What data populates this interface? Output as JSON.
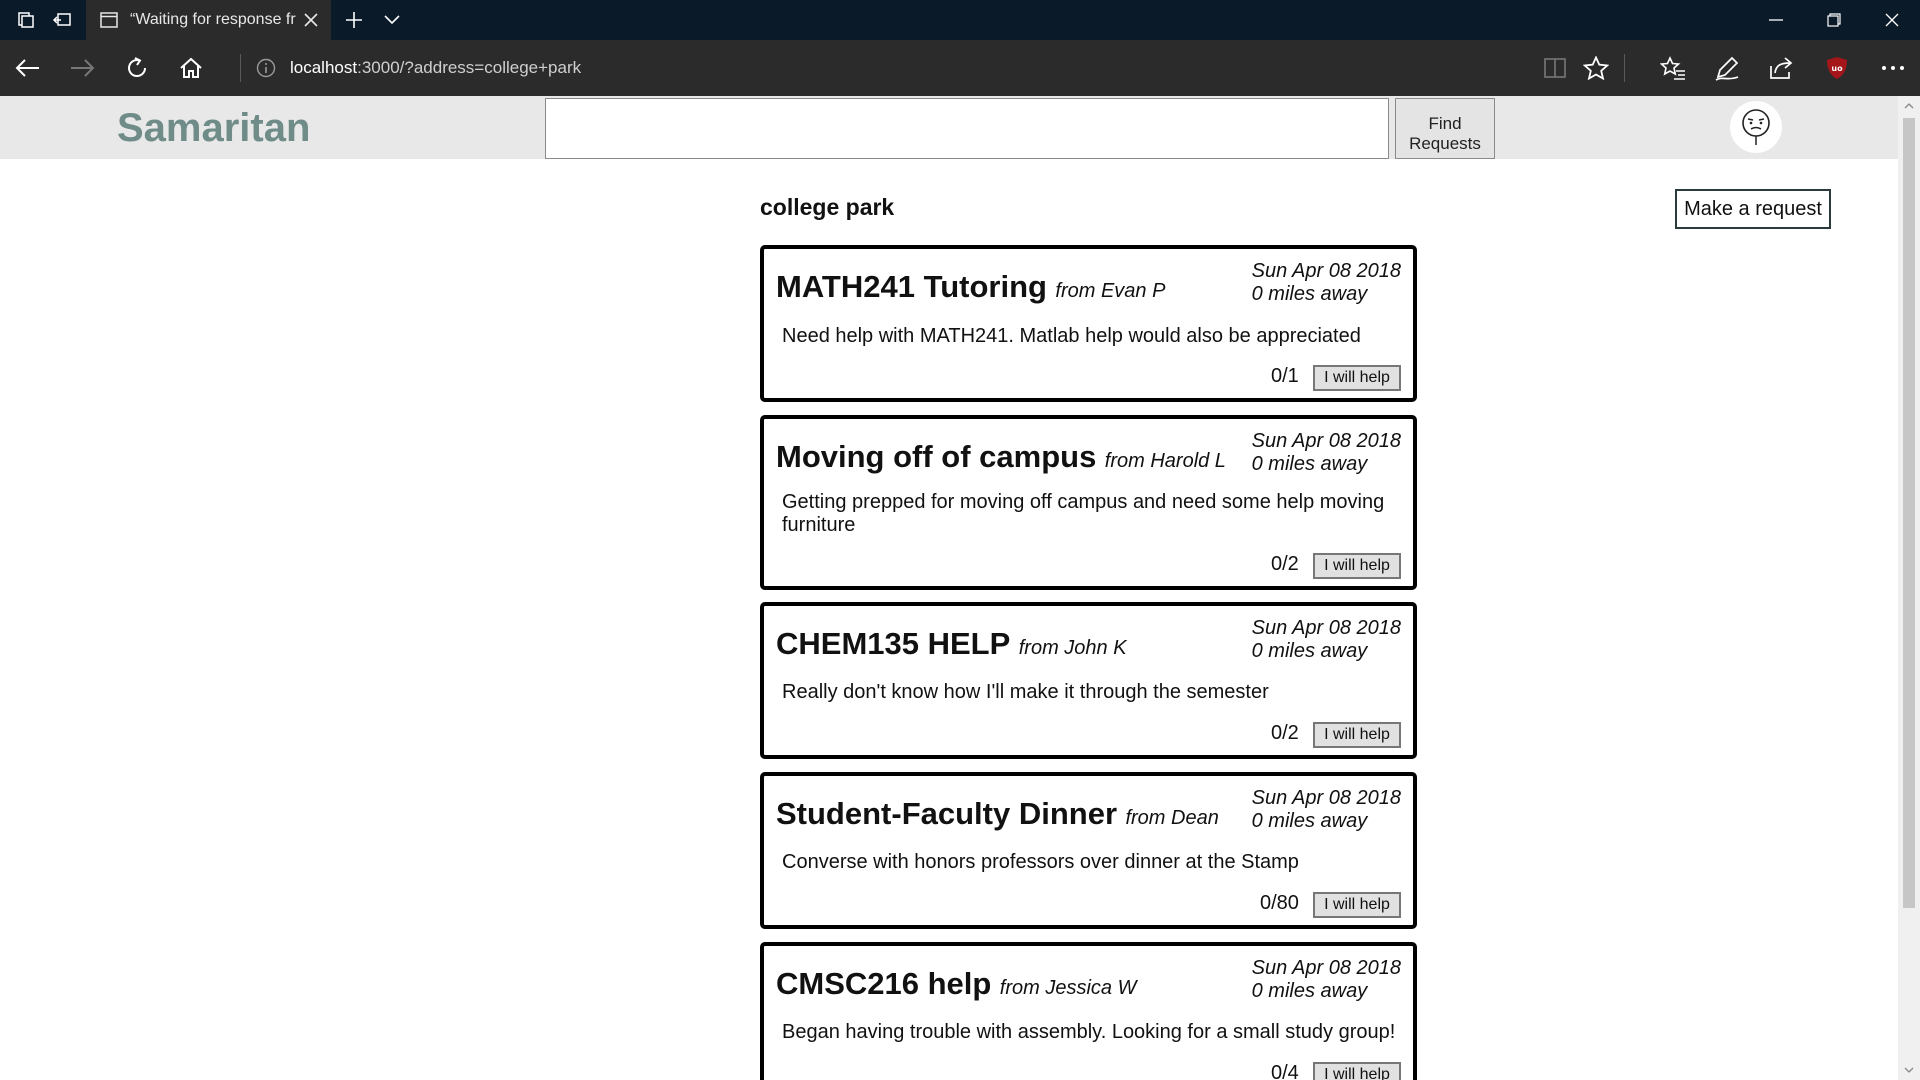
{
  "browser": {
    "tab_title": "“Waiting for response fr",
    "address_host": "localhost",
    "address_rest": ":3000/?address=college+park"
  },
  "app": {
    "brand": "Samaritan",
    "search_value": "",
    "find_label_line1": "Find",
    "find_label_line2": "Requests",
    "location": "college park",
    "make_request_label": "Make a request"
  },
  "requests": [
    {
      "title": "MATH241 Tutoring",
      "from": "from Evan P",
      "date": "Sun Apr 08 2018",
      "distance": "0 miles away",
      "description": "Need help with MATH241. Matlab help would also be appreciated",
      "count": "0/1",
      "button": "I will help"
    },
    {
      "title": "Moving off of campus",
      "from": "from Harold L",
      "date": "Sun Apr 08 2018",
      "distance": "0 miles away",
      "description": "Getting prepped for moving off campus and need some help moving furniture",
      "count": "0/2",
      "button": "I will help"
    },
    {
      "title": "CHEM135 HELP",
      "from": "from John K",
      "date": "Sun Apr 08 2018",
      "distance": "0 miles away",
      "description": "Really don't know how I'll make it through the semester",
      "count": "0/2",
      "button": "I will help"
    },
    {
      "title": "Student-Faculty Dinner",
      "from": "from Dean",
      "date": "Sun Apr 08 2018",
      "distance": "0 miles away",
      "description": "Converse with honors professors over dinner at the Stamp",
      "count": "0/80",
      "button": "I will help"
    },
    {
      "title": "CMSC216 help",
      "from": "from Jessica W",
      "date": "Sun Apr 08 2018",
      "distance": "0 miles away",
      "description": "Began having trouble with assembly. Looking for a small study group!",
      "count": "0/4",
      "button": "I will help"
    }
  ]
}
